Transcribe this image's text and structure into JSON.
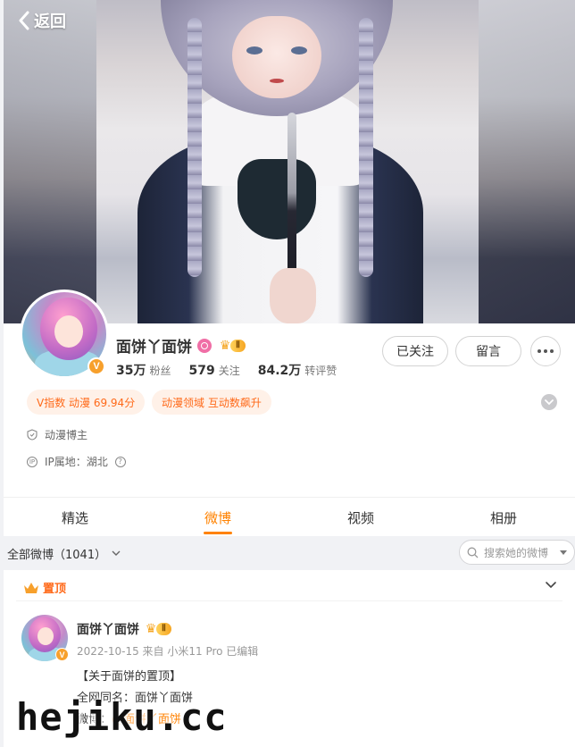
{
  "nav": {
    "back_label": "返回"
  },
  "profile": {
    "name": "面饼丫面饼",
    "vip_level": "Ⅱ",
    "verified_mark": "V",
    "stats": [
      {
        "value": "35万",
        "label": "粉丝"
      },
      {
        "value": "579",
        "label": "关注"
      },
      {
        "value": "84.2万",
        "label": "转评赞"
      }
    ],
    "follow_label": "已关注",
    "message_label": "留言",
    "tags": [
      "V指数 动漫 69.94分",
      "动漫领域 互动数飙升"
    ],
    "role": "动漫博主",
    "ip_location": "IP属地：湖北"
  },
  "tabs": [
    {
      "label": "精选",
      "active": false
    },
    {
      "label": "微博",
      "active": true
    },
    {
      "label": "视频",
      "active": false
    },
    {
      "label": "相册",
      "active": false
    }
  ],
  "filter": {
    "all_label": "全部微博（1041）",
    "search_placeholder": "搜索她的微博"
  },
  "post": {
    "pinned_label": "置顶",
    "author": "面饼丫面饼",
    "vip_level": "Ⅱ",
    "meta": "2022-10-15  来自 小米11 Pro  已编辑",
    "line1": "【关于面饼的置顶】",
    "line2": "全网同名：面饼丫面饼",
    "line3_prefix": "微博：",
    "line3_link": "@面饼丫面饼"
  },
  "watermark": "hejiku.cc",
  "colors": {
    "accent": "#ff8200",
    "tag_text": "#ff6a1a",
    "tag_bg": "#fff1e8",
    "verified": "#f7a02c"
  }
}
